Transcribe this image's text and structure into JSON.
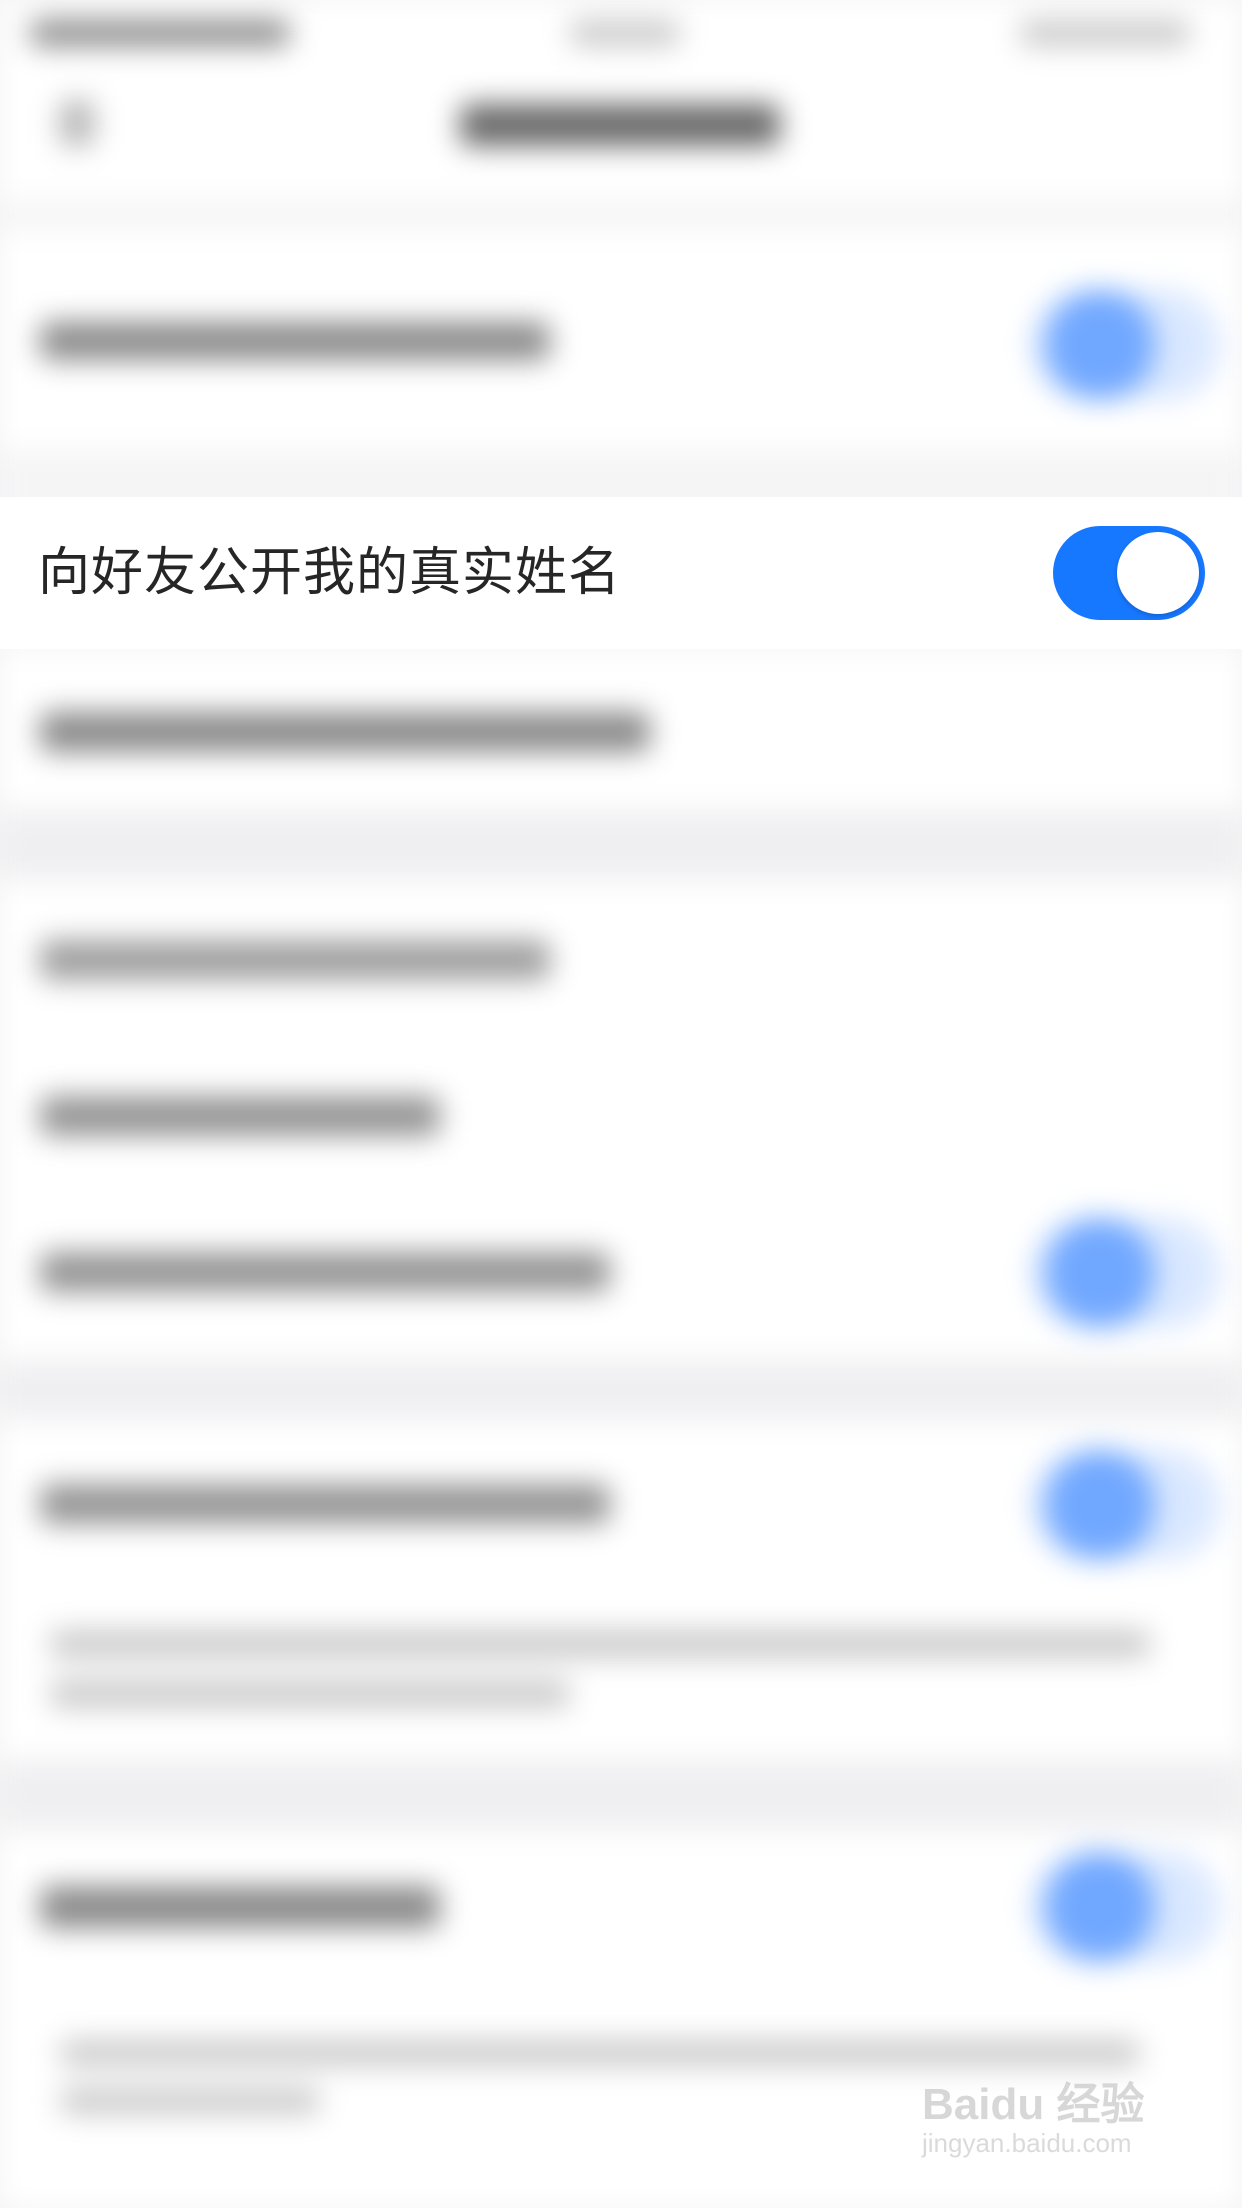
{
  "setting": {
    "label": "向好友公开我的真实姓名",
    "enabled": true
  },
  "colors": {
    "accent": "#1677ff",
    "background": "#f4f4f5",
    "row_background": "#ffffff"
  },
  "watermark": {
    "main": "Baidu 经验",
    "sub": "jingyan.baidu.com"
  }
}
